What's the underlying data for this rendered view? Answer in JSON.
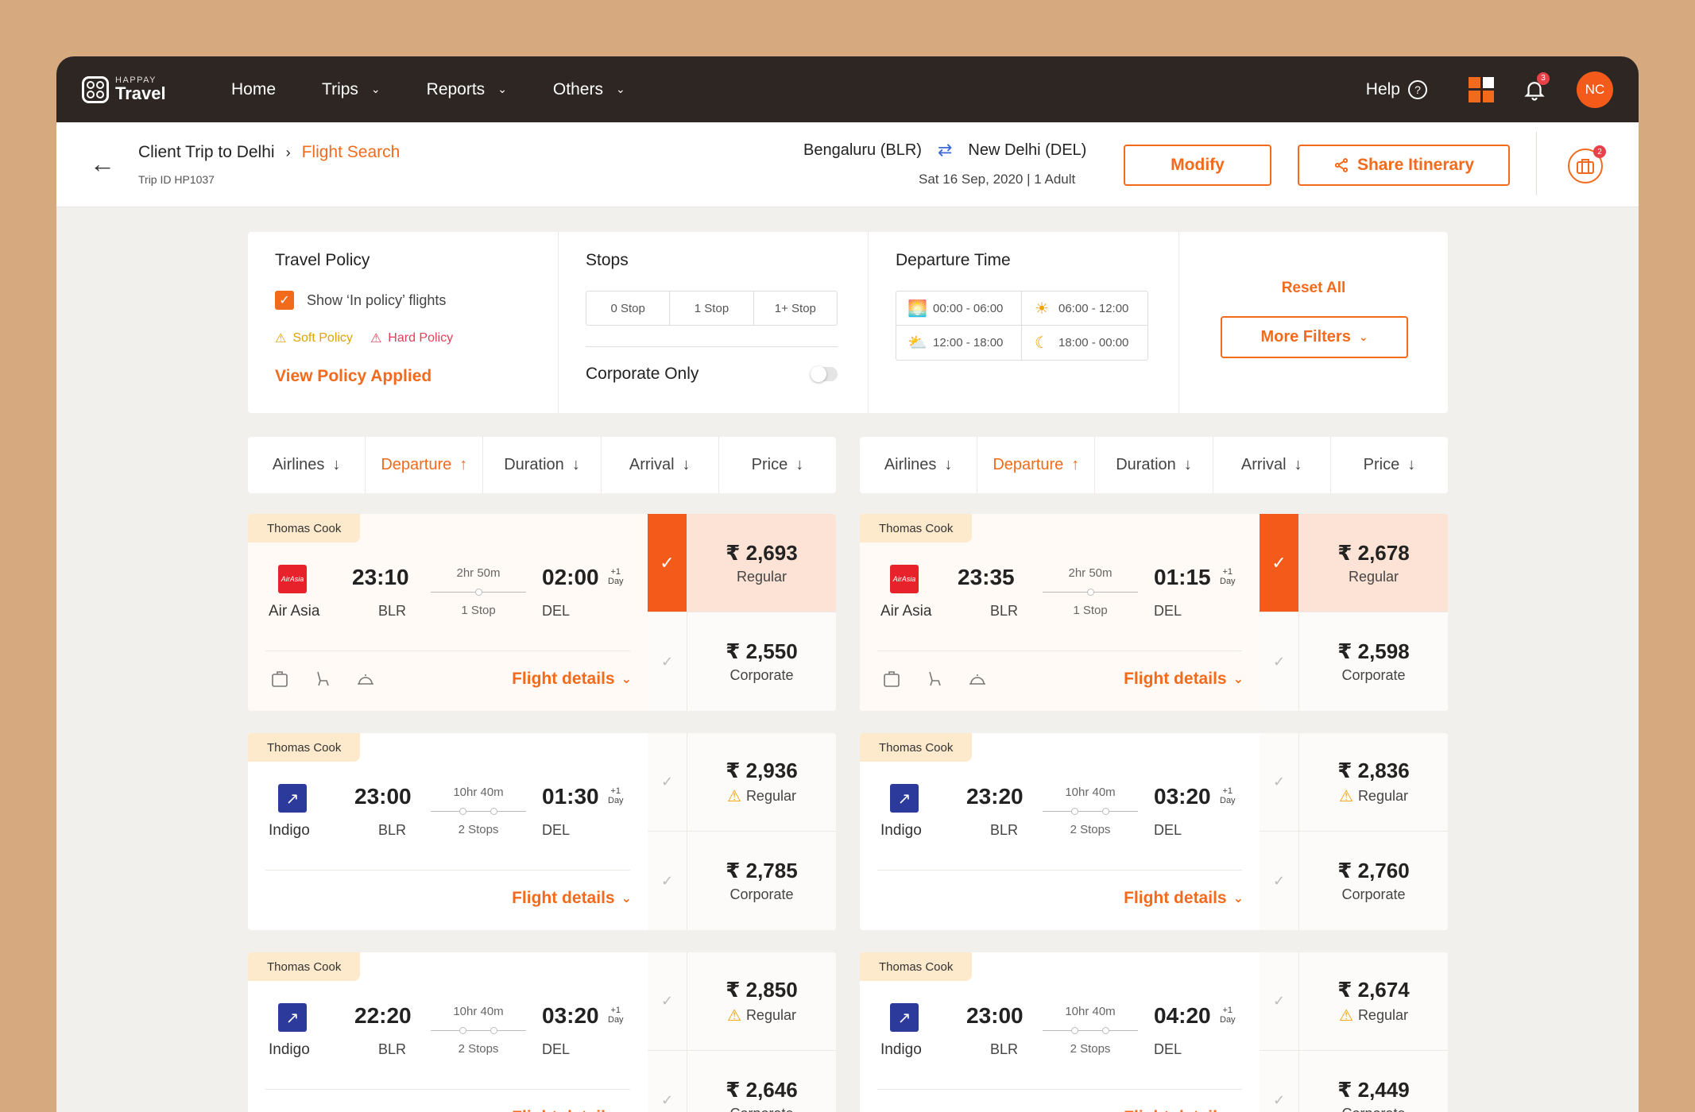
{
  "brand": {
    "small": "HAPPAY",
    "big": "Travel"
  },
  "nav": [
    {
      "label": "Home",
      "dropdown": false
    },
    {
      "label": "Trips",
      "dropdown": true
    },
    {
      "label": "Reports",
      "dropdown": true
    },
    {
      "label": "Others",
      "dropdown": true
    }
  ],
  "header": {
    "help": "Help",
    "notif_count": "3",
    "avatar": "NC",
    "cart_count": "2"
  },
  "sub": {
    "trip": "Client Trip to Delhi",
    "current": "Flight Search",
    "trip_id": "Trip ID HP1037",
    "from": "Bengaluru (BLR)",
    "to": "New Delhi (DEL)",
    "meta": "Sat 16 Sep, 2020  |  1 Adult",
    "modify": "Modify",
    "share": "Share Itinerary"
  },
  "filters": {
    "policy": {
      "title": "Travel Policy",
      "checkbox": "Show ‘In policy’ flights",
      "soft": "Soft Policy",
      "hard": "Hard Policy",
      "view": "View Policy Applied"
    },
    "stops": {
      "title": "Stops",
      "options": [
        "0 Stop",
        "1 Stop",
        "1+ Stop"
      ],
      "corporate": "Corporate Only"
    },
    "departure": {
      "title": "Departure Time",
      "slots": [
        {
          "label": "00:00 - 06:00",
          "icon": "sunrise-icon"
        },
        {
          "label": "06:00 - 12:00",
          "icon": "sun-icon"
        },
        {
          "label": "12:00 - 18:00",
          "icon": "sunset-icon"
        },
        {
          "label": "18:00 - 00:00",
          "icon": "moon-icon"
        }
      ]
    },
    "reset": "Reset All",
    "more": "More Filters"
  },
  "sort": [
    {
      "label": "Airlines",
      "dir": "↓",
      "active": false
    },
    {
      "label": "Departure",
      "dir": "↑",
      "active": true
    },
    {
      "label": "Duration",
      "dir": "↓",
      "active": false
    },
    {
      "label": "Arrival",
      "dir": "↓",
      "active": false
    },
    {
      "label": "Price",
      "dir": "↓",
      "active": false
    }
  ],
  "accent": "#f26b1d",
  "columns": [
    [
      {
        "vendor": "Thomas Cook",
        "airline": "Air Asia",
        "logo": "aa",
        "dep": "23:10",
        "from": "BLR",
        "dur": "2hr 50m",
        "stops": "1 Stop",
        "stopcount": 1,
        "arr": "02:00",
        "to": "DEL",
        "plus": "+1",
        "plus2": "Day",
        "amenities": true,
        "selected": true,
        "p1": "₹ 2,693",
        "l1": "Regular",
        "w1": false,
        "p2": "₹ 2,550",
        "l2": "Corporate",
        "details": "Flight details"
      },
      {
        "vendor": "Thomas Cook",
        "airline": "Indigo",
        "logo": "ig",
        "dep": "23:00",
        "from": "BLR",
        "dur": "10hr 40m",
        "stops": "2 Stops",
        "stopcount": 2,
        "arr": "01:30",
        "to": "DEL",
        "plus": "+1",
        "plus2": "Day",
        "amenities": false,
        "selected": false,
        "p1": "₹ 2,936",
        "l1": "Regular",
        "w1": true,
        "p2": "₹ 2,785",
        "l2": "Corporate",
        "details": "Flight details"
      },
      {
        "vendor": "Thomas Cook",
        "airline": "Indigo",
        "logo": "ig",
        "dep": "22:20",
        "from": "BLR",
        "dur": "10hr 40m",
        "stops": "2 Stops",
        "stopcount": 2,
        "arr": "03:20",
        "to": "DEL",
        "plus": "+1",
        "plus2": "Day",
        "amenities": false,
        "selected": false,
        "p1": "₹ 2,850",
        "l1": "Regular",
        "w1": true,
        "p2": "₹ 2,646",
        "l2": "Corporate",
        "details": "Flight details"
      }
    ],
    [
      {
        "vendor": "Thomas Cook",
        "airline": "Air Asia",
        "logo": "aa",
        "dep": "23:35",
        "from": "BLR",
        "dur": "2hr 50m",
        "stops": "1 Stop",
        "stopcount": 1,
        "arr": "01:15",
        "to": "DEL",
        "plus": "+1",
        "plus2": "Day",
        "amenities": true,
        "selected": true,
        "p1": "₹ 2,678",
        "l1": "Regular",
        "w1": false,
        "p2": "₹ 2,598",
        "l2": "Corporate",
        "details": "Flight details"
      },
      {
        "vendor": "Thomas Cook",
        "airline": "Indigo",
        "logo": "ig",
        "dep": "23:20",
        "from": "BLR",
        "dur": "10hr 40m",
        "stops": "2 Stops",
        "stopcount": 2,
        "arr": "03:20",
        "to": "DEL",
        "plus": "+1",
        "plus2": "Day",
        "amenities": false,
        "selected": false,
        "p1": "₹ 2,836",
        "l1": "Regular",
        "w1": true,
        "p2": "₹ 2,760",
        "l2": "Corporate",
        "details": "Flight details"
      },
      {
        "vendor": "Thomas Cook",
        "airline": "Indigo",
        "logo": "ig",
        "dep": "23:00",
        "from": "BLR",
        "dur": "10hr 40m",
        "stops": "2 Stops",
        "stopcount": 2,
        "arr": "04:20",
        "to": "DEL",
        "plus": "+1",
        "plus2": "Day",
        "amenities": false,
        "selected": false,
        "p1": "₹ 2,674",
        "l1": "Regular",
        "w1": true,
        "p2": "₹ 2,449",
        "l2": "Corporate",
        "details": "Flight details"
      }
    ]
  ]
}
